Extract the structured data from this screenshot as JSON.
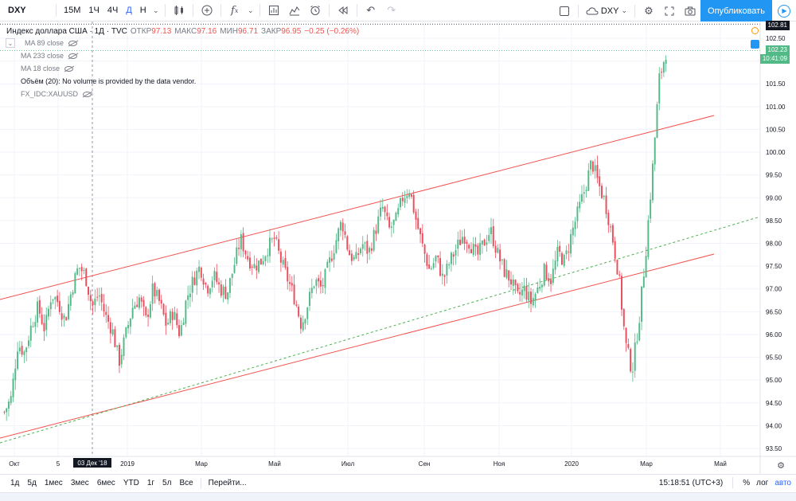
{
  "toolbar": {
    "symbol": "DXY",
    "intervals": [
      "15М",
      "1Ч",
      "4Ч",
      "Д",
      "Н"
    ],
    "active_interval": "Д",
    "compare_symbol": "DXY",
    "publish_label": "Опубликовать"
  },
  "legend": {
    "title": "Индекс доллара США · 1Д · TVC",
    "open_label": "ОТКР",
    "open": "97.13",
    "high_label": "МАКС",
    "high": "97.16",
    "low_label": "МИН",
    "low": "96.71",
    "close_label": "ЗАКР",
    "close": "96.95",
    "change": "−0.25 (−0.26%)",
    "indicators": [
      "MA 89 close",
      "MA 233 close",
      "MA 18 close",
      "Объём (20): No volume is provided by the data vendor.",
      "FX_IDC:XAUUSD"
    ]
  },
  "price_scale": {
    "ticks": [
      "102.50",
      "102.00",
      "101.50",
      "101.00",
      "100.50",
      "100.00",
      "99.50",
      "99.00",
      "98.50",
      "98.00",
      "97.50",
      "97.00",
      "96.50",
      "96.00",
      "95.50",
      "95.00",
      "94.50",
      "94.00",
      "93.50"
    ],
    "high_tag": "102.81",
    "last_tag": "102.23",
    "countdown_tag": "10:41:09"
  },
  "time_scale": {
    "ticks": [
      "Окт",
      "5",
      "2019",
      "Мар",
      "Май",
      "Июл",
      "Сен",
      "Ноя",
      "2020",
      "Мар",
      "Май"
    ],
    "crosshair_label": "03 Дек '18"
  },
  "bottombar": {
    "ranges": [
      "1д",
      "5д",
      "1мес",
      "3мес",
      "6мес",
      "YTD",
      "1г",
      "5л",
      "Все"
    ],
    "goto_label": "Перейти...",
    "clock": "15:18:51 (UTC+3)",
    "percent_label": "%",
    "log_label": "лог",
    "auto_label": "авто"
  },
  "colors": {
    "up": "#53b987",
    "down": "#eb4d5c",
    "channel": "#f2524e",
    "trend_dashed": "#4caf50",
    "accent": "#2196f3"
  },
  "chart_data": {
    "type": "candlestick",
    "symbol": "DXY",
    "ylim": [
      93.3,
      102.9
    ],
    "x_labels": [
      "Окт",
      "5",
      "2019",
      "Мар",
      "Май",
      "Июл",
      "Сен",
      "Ноя",
      "2020",
      "Мар",
      "Май"
    ],
    "path_points": [
      [
        0,
        94.3
      ],
      [
        2,
        94.6
      ],
      [
        4,
        95.8
      ],
      [
        6,
        95.6
      ],
      [
        8,
        96.2
      ],
      [
        10,
        96.6
      ],
      [
        12,
        96.1
      ],
      [
        14,
        96.9
      ],
      [
        16,
        96.7
      ],
      [
        18,
        96.3
      ],
      [
        20,
        97.0
      ],
      [
        22,
        97.5
      ],
      [
        24,
        97.3
      ],
      [
        26,
        96.6
      ],
      [
        28,
        96.9
      ],
      [
        30,
        96.4
      ],
      [
        32,
        96.1
      ],
      [
        34,
        95.4
      ],
      [
        36,
        96.0
      ],
      [
        38,
        96.6
      ],
      [
        40,
        96.8
      ],
      [
        42,
        96.3
      ],
      [
        44,
        97.0
      ],
      [
        46,
        96.7
      ],
      [
        48,
        96.2
      ],
      [
        50,
        96.5
      ],
      [
        52,
        96.0
      ],
      [
        54,
        96.8
      ],
      [
        56,
        97.2
      ],
      [
        58,
        97.5
      ],
      [
        60,
        97.0
      ],
      [
        62,
        97.3
      ],
      [
        64,
        97.0
      ],
      [
        66,
        96.9
      ],
      [
        68,
        97.5
      ],
      [
        70,
        98.1
      ],
      [
        72,
        97.7
      ],
      [
        74,
        97.5
      ],
      [
        76,
        97.6
      ],
      [
        78,
        97.9
      ],
      [
        80,
        98.1
      ],
      [
        82,
        97.6
      ],
      [
        84,
        97.2
      ],
      [
        86,
        96.8
      ],
      [
        88,
        96.2
      ],
      [
        90,
        96.7
      ],
      [
        92,
        97.2
      ],
      [
        94,
        97.0
      ],
      [
        96,
        97.5
      ],
      [
        98,
        98.0
      ],
      [
        100,
        98.5
      ],
      [
        102,
        97.8
      ],
      [
        104,
        97.6
      ],
      [
        106,
        98.0
      ],
      [
        108,
        97.8
      ],
      [
        110,
        98.3
      ],
      [
        112,
        98.8
      ],
      [
        114,
        98.3
      ],
      [
        116,
        98.5
      ],
      [
        118,
        99.0
      ],
      [
        120,
        99.2
      ],
      [
        122,
        98.5
      ],
      [
        124,
        97.9
      ],
      [
        126,
        97.4
      ],
      [
        128,
        97.7
      ],
      [
        130,
        97.2
      ],
      [
        132,
        97.6
      ],
      [
        134,
        97.9
      ],
      [
        136,
        98.2
      ],
      [
        138,
        98.0
      ],
      [
        140,
        97.7
      ],
      [
        142,
        98.0
      ],
      [
        144,
        98.3
      ],
      [
        146,
        97.8
      ],
      [
        148,
        97.4
      ],
      [
        150,
        97.2
      ],
      [
        152,
        96.8
      ],
      [
        154,
        97.0
      ],
      [
        156,
        96.7
      ],
      [
        158,
        97.0
      ],
      [
        160,
        97.4
      ],
      [
        162,
        97.2
      ],
      [
        164,
        97.8
      ],
      [
        166,
        97.6
      ],
      [
        168,
        98.2
      ],
      [
        170,
        98.7
      ],
      [
        172,
        99.2
      ],
      [
        174,
        99.8
      ],
      [
        176,
        99.3
      ],
      [
        178,
        98.9
      ],
      [
        180,
        98.2
      ],
      [
        182,
        97.3
      ],
      [
        184,
        95.8
      ],
      [
        186,
        95.2
      ],
      [
        188,
        96.3
      ],
      [
        190,
        97.8
      ],
      [
        192,
        99.6
      ],
      [
        194,
        101.6
      ],
      [
        196,
        102.2
      ]
    ]
  }
}
